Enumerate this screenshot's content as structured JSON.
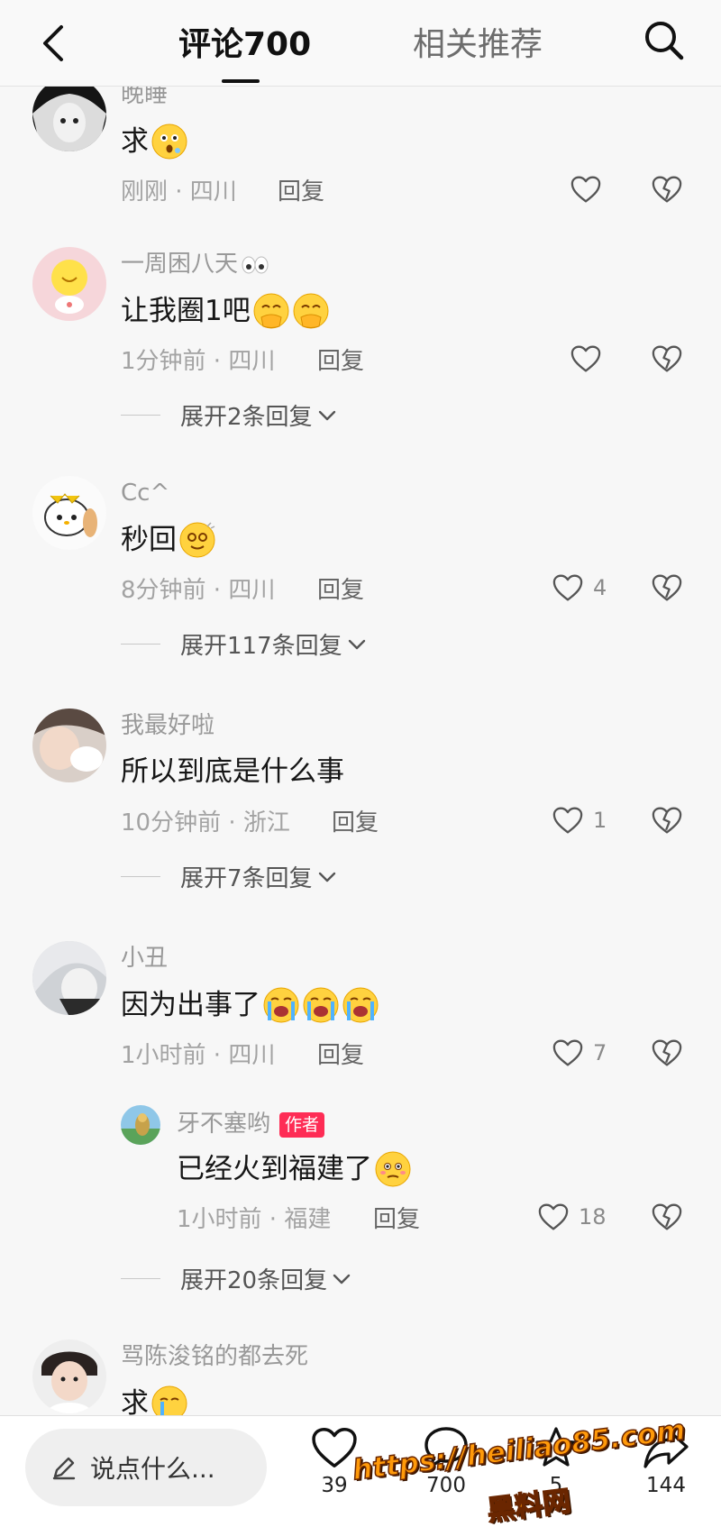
{
  "header": {
    "tab_comments": "评论700",
    "tab_related": "相关推荐"
  },
  "comments": [
    {
      "username": "晚睡",
      "text": "求",
      "emojis": [
        "shocked-face-emoji"
      ],
      "time": "刚刚 · 四川",
      "reply": "回复",
      "likes": ""
    },
    {
      "username": "一周困八天",
      "username_emoji": "eyes-emoji",
      "text": "让我圈1吧",
      "emojis": [
        "hand-over-mouth-emoji",
        "hand-over-mouth-emoji"
      ],
      "time": "1分钟前 · 四川",
      "reply": "回复",
      "likes": "",
      "expand": "展开2条回复"
    },
    {
      "username": "Cc^",
      "text": "秒回",
      "emojis": [
        "dizzy-face-emoji"
      ],
      "time": "8分钟前 · 四川",
      "reply": "回复",
      "likes": "4",
      "expand": "展开117条回复"
    },
    {
      "username": "我最好啦",
      "text": "所以到底是什么事",
      "emojis": [],
      "time": "10分钟前 · 浙江",
      "reply": "回复",
      "likes": "1",
      "expand": "展开7条回复"
    },
    {
      "username": "小丑",
      "text": "因为出事了",
      "emojis": [
        "loudly-crying-emoji",
        "loudly-crying-emoji",
        "loudly-crying-emoji"
      ],
      "time": "1小时前 · 四川",
      "reply": "回复",
      "likes": "7",
      "sub_reply": {
        "username": "牙不塞哟",
        "badge": "作者",
        "text": "已经火到福建了",
        "emojis": [
          "flushed-face-emoji"
        ],
        "time": "1小时前 · 福建",
        "reply": "回复",
        "likes": "18"
      },
      "expand": "展开20条回复"
    },
    {
      "username": "骂陈浚铭的都去死",
      "text": "求",
      "emojis": [
        "crying-face-emoji"
      ]
    }
  ],
  "bottom_bar": {
    "input_placeholder": "说点什么...",
    "likes_count": "39",
    "comments_count": "700",
    "favorites_count": "5",
    "shares_count": "144"
  },
  "watermark": {
    "url": "https://heiliao85.com",
    "name": "黑料网"
  },
  "colors": {
    "author_badge": "#fe2c55",
    "watermark": "#ff9a0a"
  }
}
